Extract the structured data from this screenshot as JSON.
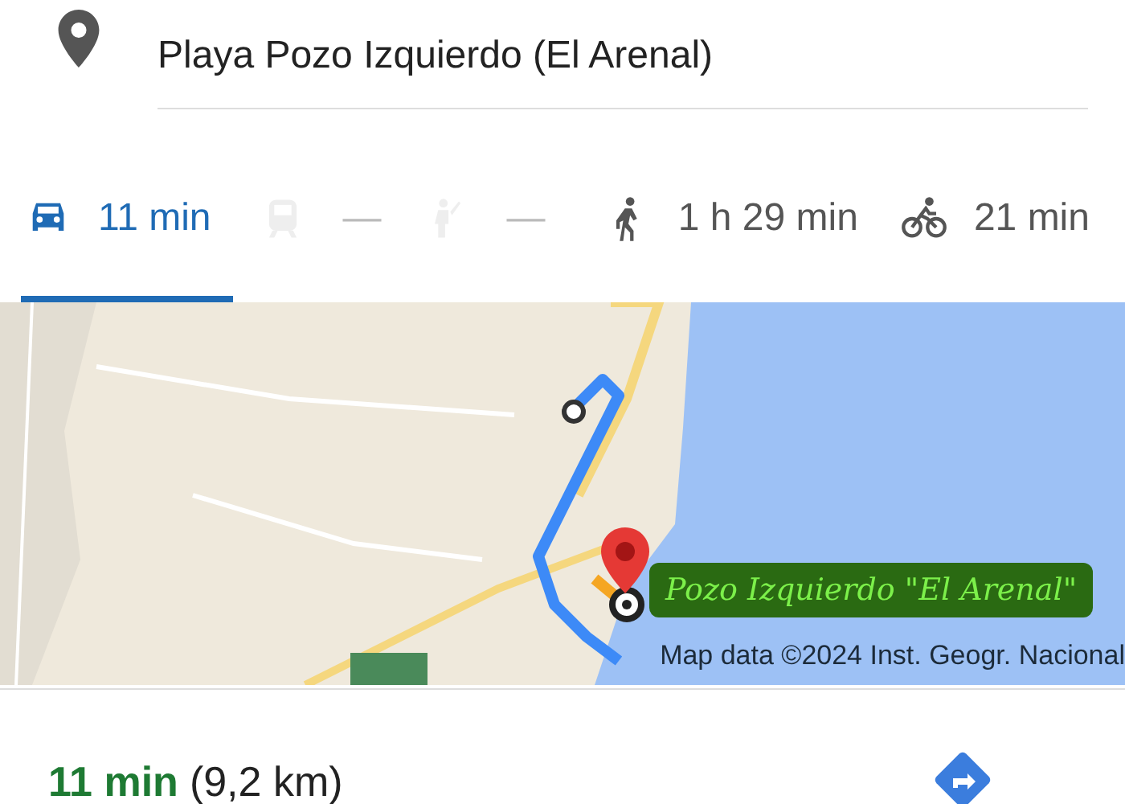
{
  "destination": {
    "value": "Playa Pozo Izquierdo (El Arenal)"
  },
  "modes": [
    {
      "kind": "car",
      "label": "11 min",
      "selected": true,
      "disabled": false
    },
    {
      "kind": "transit",
      "label": "—",
      "selected": false,
      "disabled": true
    },
    {
      "kind": "rideshare",
      "label": "—",
      "selected": false,
      "disabled": true
    },
    {
      "kind": "walk",
      "label": "1 h 29 min",
      "selected": false,
      "disabled": false
    },
    {
      "kind": "bike",
      "label": "21 min",
      "selected": false,
      "disabled": false
    }
  ],
  "map": {
    "destination_label": "Pozo Izquierdo \"El Arenal\"",
    "attribution": "Map data ©2024 Inst. Geogr. Nacional"
  },
  "summary": {
    "duration": "11 min",
    "distance": "(9,2 km)"
  }
}
